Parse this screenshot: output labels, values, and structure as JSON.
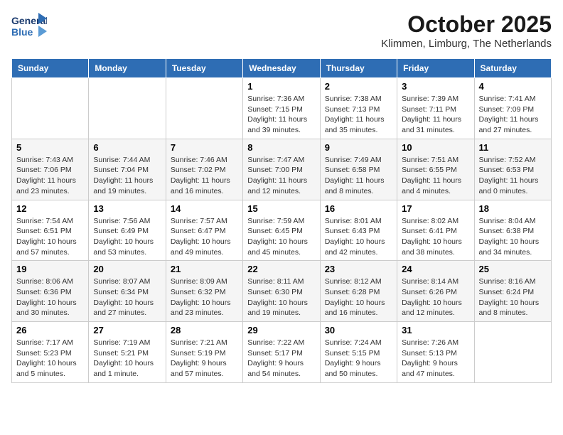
{
  "header": {
    "logo_line1": "General",
    "logo_line2": "Blue",
    "month": "October 2025",
    "location": "Klimmen, Limburg, The Netherlands"
  },
  "weekdays": [
    "Sunday",
    "Monday",
    "Tuesday",
    "Wednesday",
    "Thursday",
    "Friday",
    "Saturday"
  ],
  "weeks": [
    [
      {
        "day": "",
        "sunrise": "",
        "sunset": "",
        "daylight": ""
      },
      {
        "day": "",
        "sunrise": "",
        "sunset": "",
        "daylight": ""
      },
      {
        "day": "",
        "sunrise": "",
        "sunset": "",
        "daylight": ""
      },
      {
        "day": "1",
        "sunrise": "Sunrise: 7:36 AM",
        "sunset": "Sunset: 7:15 PM",
        "daylight": "Daylight: 11 hours and 39 minutes."
      },
      {
        "day": "2",
        "sunrise": "Sunrise: 7:38 AM",
        "sunset": "Sunset: 7:13 PM",
        "daylight": "Daylight: 11 hours and 35 minutes."
      },
      {
        "day": "3",
        "sunrise": "Sunrise: 7:39 AM",
        "sunset": "Sunset: 7:11 PM",
        "daylight": "Daylight: 11 hours and 31 minutes."
      },
      {
        "day": "4",
        "sunrise": "Sunrise: 7:41 AM",
        "sunset": "Sunset: 7:09 PM",
        "daylight": "Daylight: 11 hours and 27 minutes."
      }
    ],
    [
      {
        "day": "5",
        "sunrise": "Sunrise: 7:43 AM",
        "sunset": "Sunset: 7:06 PM",
        "daylight": "Daylight: 11 hours and 23 minutes."
      },
      {
        "day": "6",
        "sunrise": "Sunrise: 7:44 AM",
        "sunset": "Sunset: 7:04 PM",
        "daylight": "Daylight: 11 hours and 19 minutes."
      },
      {
        "day": "7",
        "sunrise": "Sunrise: 7:46 AM",
        "sunset": "Sunset: 7:02 PM",
        "daylight": "Daylight: 11 hours and 16 minutes."
      },
      {
        "day": "8",
        "sunrise": "Sunrise: 7:47 AM",
        "sunset": "Sunset: 7:00 PM",
        "daylight": "Daylight: 11 hours and 12 minutes."
      },
      {
        "day": "9",
        "sunrise": "Sunrise: 7:49 AM",
        "sunset": "Sunset: 6:58 PM",
        "daylight": "Daylight: 11 hours and 8 minutes."
      },
      {
        "day": "10",
        "sunrise": "Sunrise: 7:51 AM",
        "sunset": "Sunset: 6:55 PM",
        "daylight": "Daylight: 11 hours and 4 minutes."
      },
      {
        "day": "11",
        "sunrise": "Sunrise: 7:52 AM",
        "sunset": "Sunset: 6:53 PM",
        "daylight": "Daylight: 11 hours and 0 minutes."
      }
    ],
    [
      {
        "day": "12",
        "sunrise": "Sunrise: 7:54 AM",
        "sunset": "Sunset: 6:51 PM",
        "daylight": "Daylight: 10 hours and 57 minutes."
      },
      {
        "day": "13",
        "sunrise": "Sunrise: 7:56 AM",
        "sunset": "Sunset: 6:49 PM",
        "daylight": "Daylight: 10 hours and 53 minutes."
      },
      {
        "day": "14",
        "sunrise": "Sunrise: 7:57 AM",
        "sunset": "Sunset: 6:47 PM",
        "daylight": "Daylight: 10 hours and 49 minutes."
      },
      {
        "day": "15",
        "sunrise": "Sunrise: 7:59 AM",
        "sunset": "Sunset: 6:45 PM",
        "daylight": "Daylight: 10 hours and 45 minutes."
      },
      {
        "day": "16",
        "sunrise": "Sunrise: 8:01 AM",
        "sunset": "Sunset: 6:43 PM",
        "daylight": "Daylight: 10 hours and 42 minutes."
      },
      {
        "day": "17",
        "sunrise": "Sunrise: 8:02 AM",
        "sunset": "Sunset: 6:41 PM",
        "daylight": "Daylight: 10 hours and 38 minutes."
      },
      {
        "day": "18",
        "sunrise": "Sunrise: 8:04 AM",
        "sunset": "Sunset: 6:38 PM",
        "daylight": "Daylight: 10 hours and 34 minutes."
      }
    ],
    [
      {
        "day": "19",
        "sunrise": "Sunrise: 8:06 AM",
        "sunset": "Sunset: 6:36 PM",
        "daylight": "Daylight: 10 hours and 30 minutes."
      },
      {
        "day": "20",
        "sunrise": "Sunrise: 8:07 AM",
        "sunset": "Sunset: 6:34 PM",
        "daylight": "Daylight: 10 hours and 27 minutes."
      },
      {
        "day": "21",
        "sunrise": "Sunrise: 8:09 AM",
        "sunset": "Sunset: 6:32 PM",
        "daylight": "Daylight: 10 hours and 23 minutes."
      },
      {
        "day": "22",
        "sunrise": "Sunrise: 8:11 AM",
        "sunset": "Sunset: 6:30 PM",
        "daylight": "Daylight: 10 hours and 19 minutes."
      },
      {
        "day": "23",
        "sunrise": "Sunrise: 8:12 AM",
        "sunset": "Sunset: 6:28 PM",
        "daylight": "Daylight: 10 hours and 16 minutes."
      },
      {
        "day": "24",
        "sunrise": "Sunrise: 8:14 AM",
        "sunset": "Sunset: 6:26 PM",
        "daylight": "Daylight: 10 hours and 12 minutes."
      },
      {
        "day": "25",
        "sunrise": "Sunrise: 8:16 AM",
        "sunset": "Sunset: 6:24 PM",
        "daylight": "Daylight: 10 hours and 8 minutes."
      }
    ],
    [
      {
        "day": "26",
        "sunrise": "Sunrise: 7:17 AM",
        "sunset": "Sunset: 5:23 PM",
        "daylight": "Daylight: 10 hours and 5 minutes."
      },
      {
        "day": "27",
        "sunrise": "Sunrise: 7:19 AM",
        "sunset": "Sunset: 5:21 PM",
        "daylight": "Daylight: 10 hours and 1 minute."
      },
      {
        "day": "28",
        "sunrise": "Sunrise: 7:21 AM",
        "sunset": "Sunset: 5:19 PM",
        "daylight": "Daylight: 9 hours and 57 minutes."
      },
      {
        "day": "29",
        "sunrise": "Sunrise: 7:22 AM",
        "sunset": "Sunset: 5:17 PM",
        "daylight": "Daylight: 9 hours and 54 minutes."
      },
      {
        "day": "30",
        "sunrise": "Sunrise: 7:24 AM",
        "sunset": "Sunset: 5:15 PM",
        "daylight": "Daylight: 9 hours and 50 minutes."
      },
      {
        "day": "31",
        "sunrise": "Sunrise: 7:26 AM",
        "sunset": "Sunset: 5:13 PM",
        "daylight": "Daylight: 9 hours and 47 minutes."
      },
      {
        "day": "",
        "sunrise": "",
        "sunset": "",
        "daylight": ""
      }
    ]
  ]
}
